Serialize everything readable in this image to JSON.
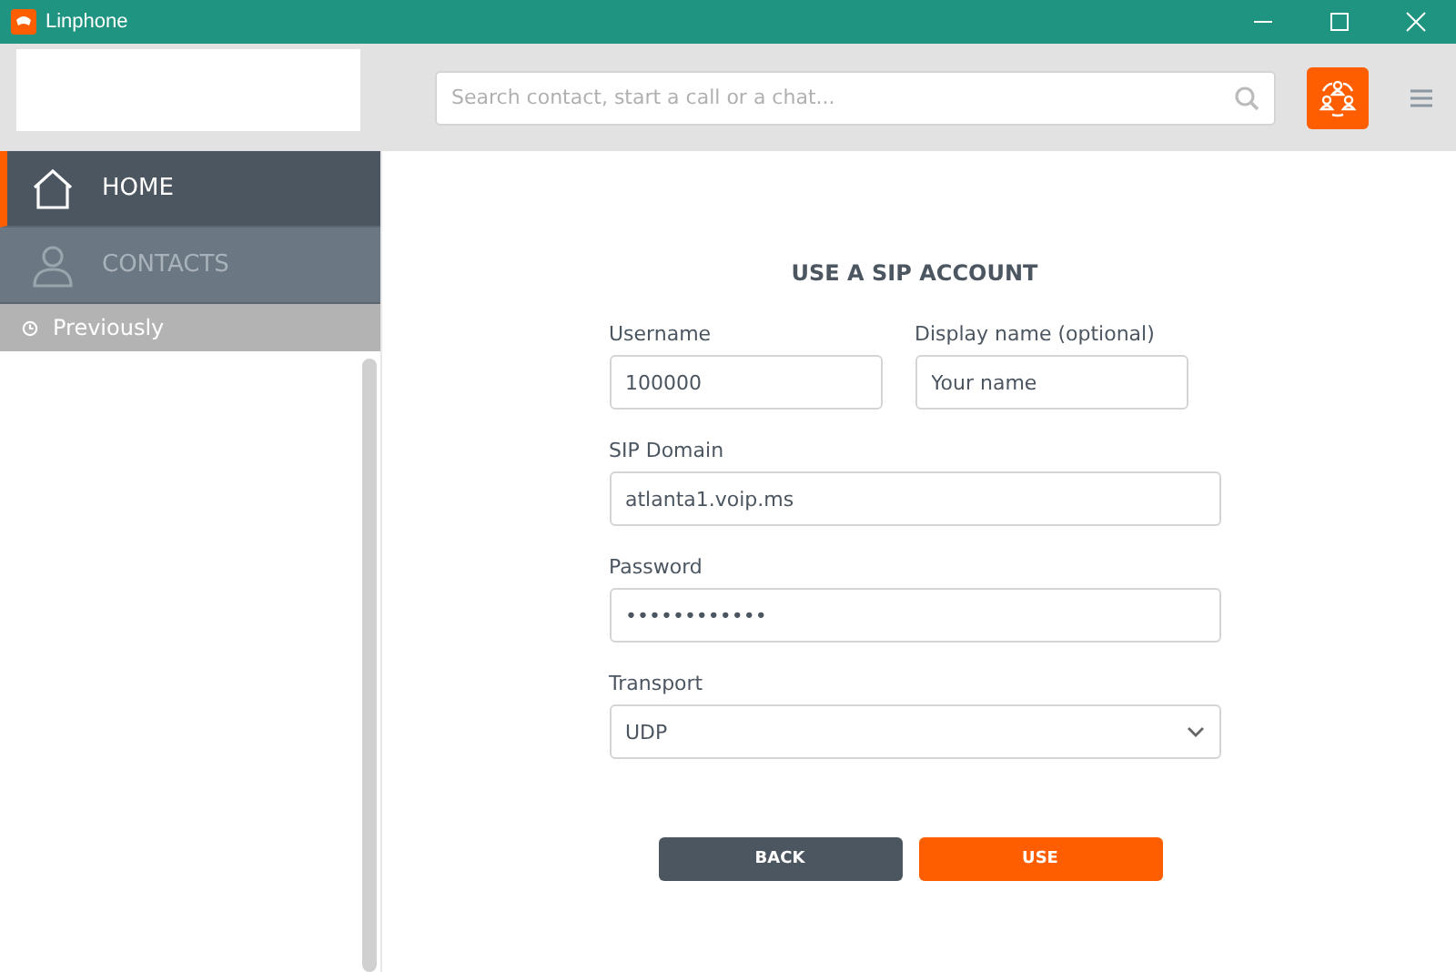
{
  "window": {
    "title": "Linphone"
  },
  "search": {
    "placeholder": "Search contact, start a call or a chat..."
  },
  "sidebar": {
    "items": [
      {
        "label": "HOME",
        "kind": "home",
        "selected": true
      },
      {
        "label": "CONTACTS",
        "kind": "contacts",
        "selected": false
      }
    ],
    "section": "Previously"
  },
  "form": {
    "title": "USE A SIP ACCOUNT",
    "rows": [
      [
        {
          "label": "Username",
          "value": "100000",
          "kind": "text"
        },
        {
          "label": "Display name (optional)",
          "placeholder": "Your name",
          "kind": "text"
        }
      ],
      [
        {
          "label": "SIP Domain",
          "value": "atlanta1.voip.ms",
          "kind": "text"
        }
      ],
      [
        {
          "label": "Password",
          "value": "••••••••••••",
          "kind": "password"
        }
      ],
      [
        {
          "label": "Transport",
          "value": "UDP",
          "kind": "select"
        }
      ]
    ],
    "buttons": [
      {
        "label": "BACK",
        "kind": "secondary"
      },
      {
        "label": "USE",
        "kind": "primary"
      }
    ]
  }
}
